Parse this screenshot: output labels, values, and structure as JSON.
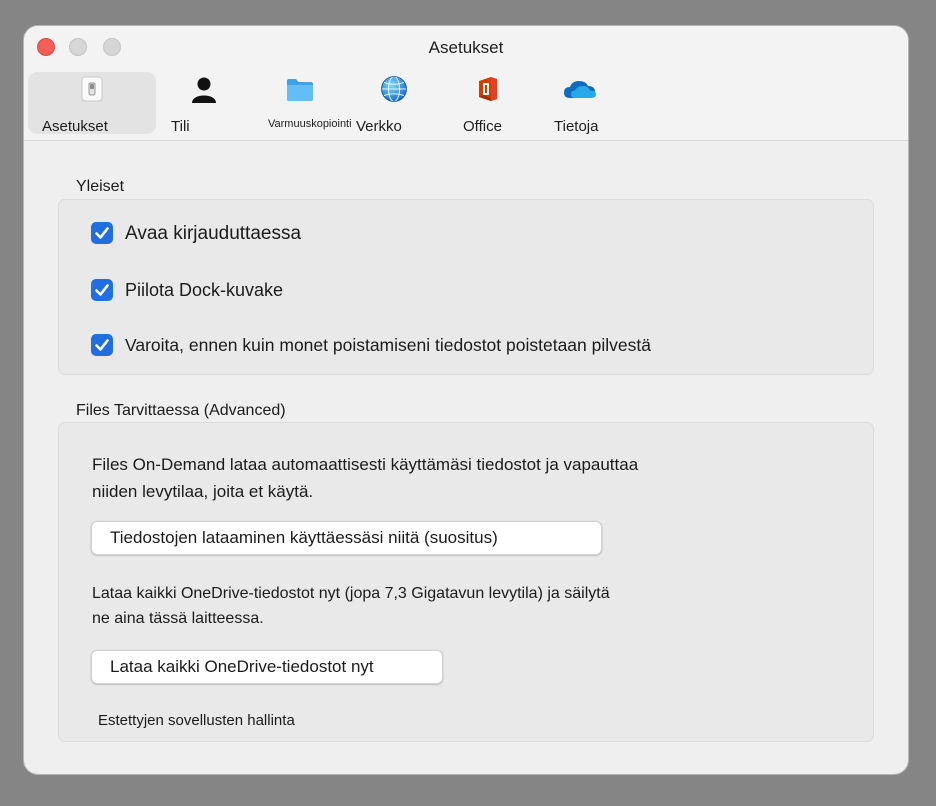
{
  "window": {
    "title": "Asetukset"
  },
  "tabs": [
    {
      "label": "Asetukset",
      "icon": "settings-switch-icon",
      "selected": true
    },
    {
      "label": "Tili",
      "icon": "person-icon",
      "selected": false
    },
    {
      "label": "Varmuuskopiointi",
      "icon": "folder-icon",
      "selected": false
    },
    {
      "label": "Verkko",
      "icon": "globe-icon",
      "selected": false
    },
    {
      "label": "Office",
      "icon": "office-logo-icon",
      "selected": false
    },
    {
      "label": "Tietoja",
      "icon": "cloud-icon",
      "selected": false
    }
  ],
  "general": {
    "title": "Yleiset",
    "options": [
      {
        "label": "Avaa kirjauduttaessa",
        "checked": true
      },
      {
        "label": "Piilota Dock-kuvake",
        "checked": true
      },
      {
        "label": "Varoita, ennen kuin monet poistamiseni tiedostot poistetaan pilvestä",
        "checked": true
      }
    ]
  },
  "files_on_demand": {
    "title": "Files Tarvittaessa (Advanced)",
    "desc1_line1": "Files On-Demand lataa automaattisesti käyttämäsi tiedostot ja vapauttaa",
    "desc1_line2": "niiden levytilaa, joita et käytä.",
    "download_on_use_button": "Tiedostojen lataaminen käyttäessäsi niitä (suositus)",
    "desc2_line1": "Lataa kaikki OneDrive-tiedostot nyt (jopa 7,3 Gigatavun levytila) ja säilytä",
    "desc2_line2": "ne aina tässä laitteessa.",
    "download_all_button": "Lataa kaikki OneDrive-tiedostot nyt",
    "blocked_apps_link": "Estettyjen sovellusten hallinta"
  },
  "colors": {
    "checkbox": "#1f6fe0",
    "close": "#f15f57",
    "onedrive": "#0f6cbd",
    "office": "#d83b01"
  }
}
